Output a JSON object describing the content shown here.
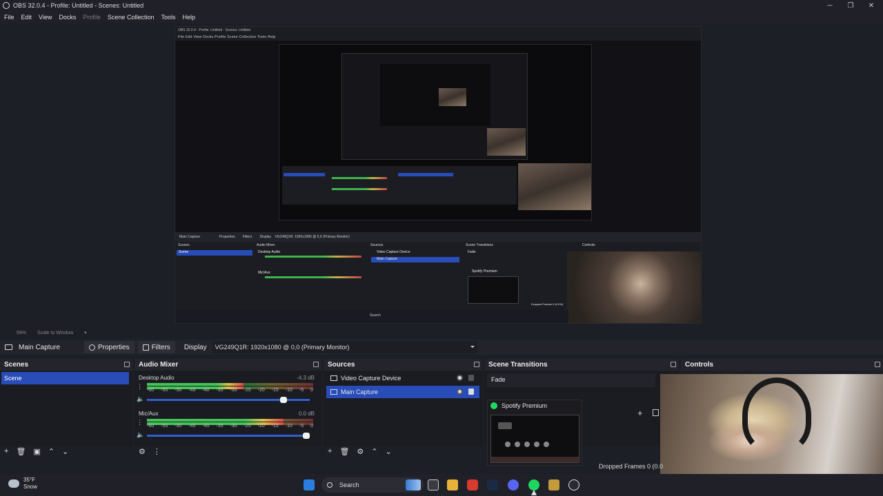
{
  "window": {
    "title": "OBS 32.0.4 - Profile: Untitled - Scenes: Untitled",
    "min": "─",
    "max": "❐",
    "close": "✕"
  },
  "menu": [
    "File",
    "Edit",
    "View",
    "Docks",
    "Profile",
    "Scene Collection",
    "Tools",
    "Help"
  ],
  "nested": {
    "title": "OBS 32.0.4 - Profile: Untitled - Scenes: Untitled",
    "menu": "File  Edit  View  Docks  Profile  Scene Collection  Tools  Help",
    "source_label": "Main Capture",
    "properties": "Properties",
    "filters": "Filters",
    "display": "Display",
    "display_value": "VG249Q1R: 1920x1080 @ 0,0 (Primary Monitor)",
    "docks": [
      "Scenes",
      "Audio Mixer",
      "Sources",
      "Scene Transitions",
      "Controls"
    ],
    "scene": "Scene",
    "desktop_audio": "Desktop Audio",
    "mic": "Mic/Aux",
    "src1": "Video Capture Device",
    "src2": "Main Capture",
    "fade": "Fade",
    "spotify": "Spotify Premium",
    "search": "Search",
    "dropped": "Dropped Frames 0 (0.0%)"
  },
  "fit": {
    "zoom": "59%",
    "mode": "Scale to Window"
  },
  "sourcebar": {
    "name": "Main Capture",
    "properties": "Properties",
    "filters": "Filters",
    "display_label": "Display",
    "display_value": "VG249Q1R: 1920x1080 @ 0,0 (Primary Monitor)"
  },
  "docks": {
    "scenes": {
      "title": "Scenes",
      "items": [
        "Scene"
      ]
    },
    "mixer": {
      "title": "Audio Mixer",
      "channels": [
        {
          "name": "Desktop Audio",
          "db": "-4.3 dB",
          "level": 0.58,
          "volume": 0.86
        },
        {
          "name": "Mic/Aux",
          "db": "0.0 dB",
          "level": 0.82,
          "volume": 1.0
        }
      ],
      "ticks": [
        "-60",
        "-55",
        "-50",
        "-45",
        "-40",
        "-35",
        "-30",
        "-25",
        "-20",
        "-15",
        "-10",
        "-5",
        "0"
      ]
    },
    "sources": {
      "title": "Sources",
      "items": [
        "Video Capture Device",
        "Main Capture"
      ]
    },
    "transitions": {
      "title": "Scene Transitions",
      "selected": "Fade"
    },
    "controls": {
      "title": "Controls",
      "dropped": "Dropped Frames 0 (0.0"
    }
  },
  "spotify": {
    "title": "Spotify Premium"
  },
  "taskbar": {
    "weather_temp": "35°F",
    "weather_desc": "Snow",
    "search": "Search"
  },
  "colors": {
    "selected": "#284cb8",
    "spotify": "#1ed760",
    "meter_green": "#43c457",
    "meter_red": "#e04848"
  }
}
